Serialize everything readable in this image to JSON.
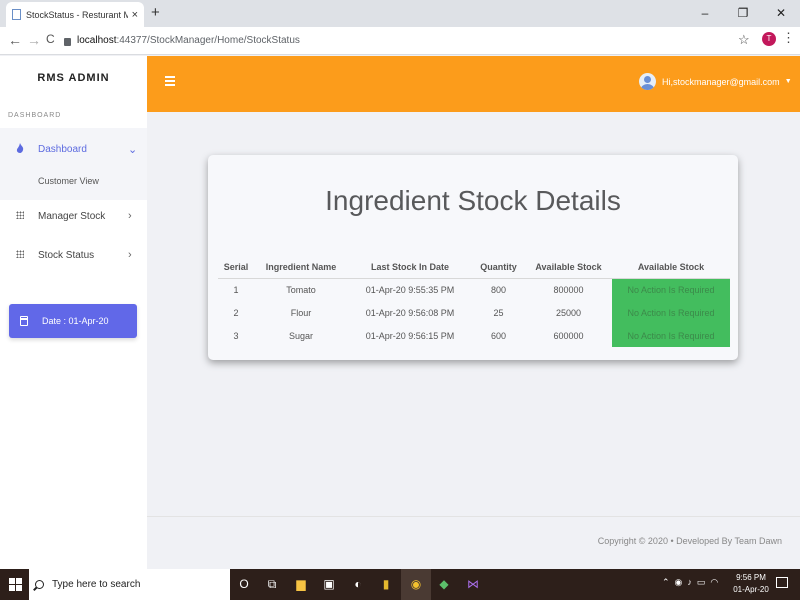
{
  "browser": {
    "tab_title": "StockStatus - Resturant Manager",
    "tab_close": "×",
    "new_tab": "+",
    "win_min": "–",
    "win_restore": "❐",
    "win_close": "✕",
    "nav_back": "←",
    "nav_forward": "→",
    "nav_reload": "C",
    "url_host": "localhost",
    "url_path": ":44377/StockManager/Home/StockStatus",
    "profile_initial": "T"
  },
  "sidebar": {
    "brand": "RMS ADMIN",
    "section_label": "DASHBOARD",
    "items": [
      {
        "label": "Dashboard",
        "icon": "flame-icon",
        "chevron": "⌄"
      },
      {
        "label": "Manager Stock",
        "icon": "grid-icon",
        "chevron": "›"
      },
      {
        "label": "Stock Status",
        "icon": "grid-icon",
        "chevron": "›"
      }
    ],
    "sub_items": [
      {
        "label": "Customer View"
      }
    ],
    "date_card": "Date : 01-Apr-20"
  },
  "header": {
    "user_label": "Hi,stockmanager@gmail.com",
    "accent": "#fc9c1b"
  },
  "main": {
    "title": "Ingredient Stock Details",
    "columns": [
      "Serial",
      "Ingredient Name",
      "Last Stock In Date",
      "Quantity",
      "Available Stock",
      "Available Stock"
    ],
    "rows": [
      {
        "serial": "1",
        "name": "Tomato",
        "date": "01-Apr-20 9:55:35 PM",
        "quantity": "800",
        "available": "800000",
        "status": "No Action Is Required"
      },
      {
        "serial": "2",
        "name": "Flour",
        "date": "01-Apr-20 9:56:08 PM",
        "quantity": "25",
        "available": "25000",
        "status": "No Action Is Required"
      },
      {
        "serial": "3",
        "name": "Sugar",
        "date": "01-Apr-20 9:56:15 PM",
        "quantity": "600",
        "available": "600000",
        "status": "No Action Is Required"
      }
    ],
    "status_color": "#43bd5e"
  },
  "footer": {
    "text": "Copyright © 2020  •  Developed By Team Dawn"
  },
  "taskbar": {
    "search_placeholder": "Type here to search",
    "time": "9:56 PM",
    "date": "01-Apr-20"
  }
}
